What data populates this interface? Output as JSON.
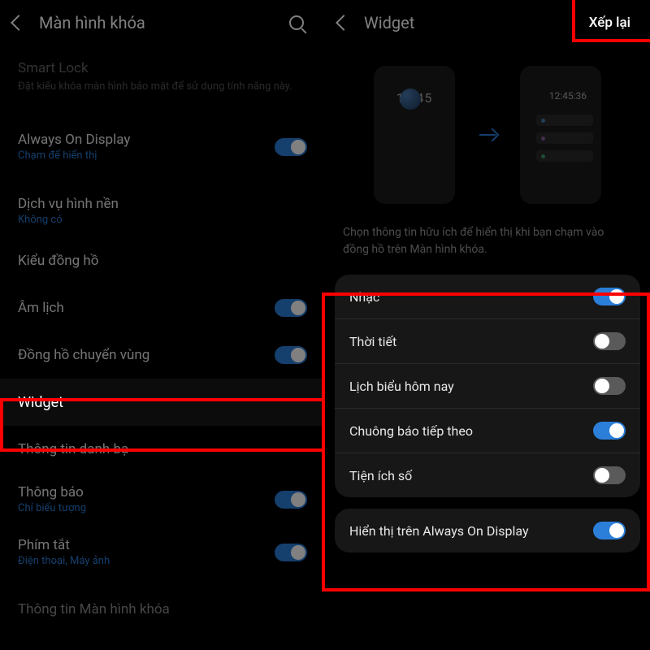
{
  "left": {
    "title": "Màn hình khóa",
    "smartLock": {
      "label": "Smart Lock",
      "desc": "Đặt kiểu khóa màn hình bảo mật để sử dụng tính năng này."
    },
    "aod": {
      "label": "Always On Display",
      "sub": "Chạm để hiển thị",
      "on": true
    },
    "wallpaper": {
      "label": "Dịch vụ hình nền",
      "sub": "Không có"
    },
    "clockStyle": {
      "label": "Kiểu đồng hồ"
    },
    "lunar": {
      "label": "Âm lịch",
      "on": true
    },
    "roaming": {
      "label": "Đồng hồ chuyển vùng",
      "on": true
    },
    "widget": {
      "label": "Widget"
    },
    "contactInfo": {
      "label": "Thông tin danh bạ"
    },
    "notifications": {
      "label": "Thông báo",
      "sub": "Chỉ biểu tượng",
      "on": true
    },
    "shortcuts": {
      "label": "Phím tắt",
      "sub": "Điện thoại, Máy ảnh",
      "on": true
    },
    "cutoff": "Thông tin Màn hình khóa"
  },
  "right": {
    "title": "Widget",
    "action": "Xếp lại",
    "previewTime1": "12:45",
    "previewTime2": "12:45:36",
    "desc": "Chọn thông tin hữu ích để hiển thị khi bạn chạm vào đồng hồ trên Màn hình khóa.",
    "items": [
      {
        "label": "Nhạc",
        "on": true
      },
      {
        "label": "Thời tiết",
        "on": false
      },
      {
        "label": "Lịch biểu hôm nay",
        "on": false
      },
      {
        "label": "Chuông báo tiếp theo",
        "on": true
      },
      {
        "label": "Tiện ích số",
        "on": false
      }
    ],
    "aodItem": {
      "label": "Hiển thị trên Always On Display",
      "on": true
    }
  }
}
